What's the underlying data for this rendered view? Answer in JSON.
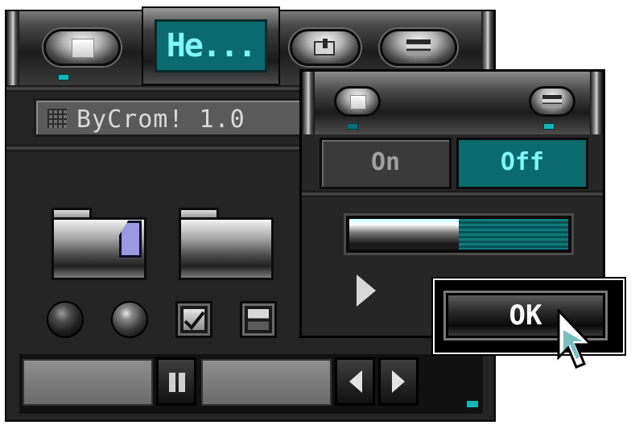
{
  "main_window": {
    "title_tab_label": "He...",
    "name_bar_text": "ByCrom! 1.0",
    "header_buttons": [
      {
        "icon": "maximize-icon"
      },
      {
        "icon": "restore-icon"
      },
      {
        "icon": "minimize-icon"
      }
    ],
    "body_icons": [
      "document-folder-icon",
      "folder-icon"
    ],
    "radios": [
      "radio-dark",
      "radio-selected"
    ],
    "checkboxes": [
      {
        "checked": true
      },
      {
        "checked": false
      }
    ],
    "bottom_controls": [
      "pause-icon",
      "arrow-left-icon",
      "arrow-right-icon"
    ]
  },
  "dialog": {
    "segment_on_label": "On",
    "segment_off_label": "Off",
    "selected_segment": "Off",
    "slider_value": 0.5
  },
  "ok_button_label": "OK",
  "colors": {
    "accent": "#0b6a6e",
    "accent_text": "#7ff7f4",
    "chrome_dark": "#242424",
    "doc_icon": "#9a9ae0"
  }
}
